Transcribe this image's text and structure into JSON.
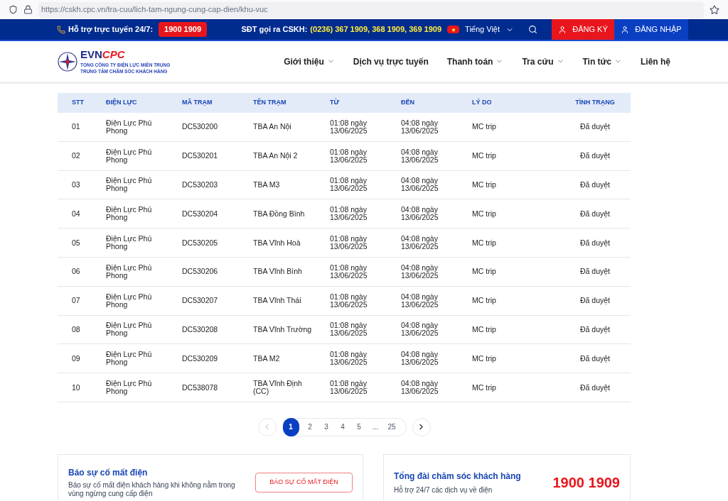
{
  "browser": {
    "url": "https://cskh.cpc.vn/tra-cuu/lich-tam-ngung-cung-cap-dien/khu-vuc"
  },
  "topbar": {
    "support_label": "Hỗ trợ trực tuyến 24/7:",
    "support_phone": "1900 1909",
    "cskh_label": "SĐT gọi ra CSKH:",
    "cskh_phones": "(0236) 367 1909, 368 1909, 369 1909",
    "language": "Tiếng Việt",
    "register": "ĐĂNG KÝ",
    "login": "ĐĂNG NHẬP"
  },
  "logo": {
    "brand_main": "EVN",
    "brand_accent": "CPC",
    "line_1": "TỔNG CÔNG TY ĐIỆN LỰC MIỀN TRUNG",
    "line_2": "TRUNG TÂM CHĂM SÓC KHÁCH HÀNG"
  },
  "nav": [
    {
      "label": "Giới thiệu",
      "dropdown": true
    },
    {
      "label": "Dịch vụ trực tuyến",
      "dropdown": false
    },
    {
      "label": "Thanh toán",
      "dropdown": true
    },
    {
      "label": "Tra cứu",
      "dropdown": true
    },
    {
      "label": "Tin tức",
      "dropdown": true
    },
    {
      "label": "Liên hệ",
      "dropdown": false
    }
  ],
  "table": {
    "columns": [
      "STT",
      "ĐIỆN LỰC",
      "MÃ TRẠM",
      "TÊN TRẠM",
      "TỪ",
      "ĐẾN",
      "LÝ DO",
      "TÌNH TRẠNG"
    ],
    "rows": [
      [
        "01",
        "Điện Lực Phú Phong",
        "DC530200",
        "TBA An Nội",
        "01:08 ngày 13/06/2025",
        "04:08 ngày 13/06/2025",
        "MC trip",
        "Đã duyệt"
      ],
      [
        "02",
        "Điện Lực Phú Phong",
        "DC530201",
        "TBA An Nội 2",
        "01:08 ngày 13/06/2025",
        "04:08 ngày 13/06/2025",
        "MC trip",
        "Đã duyệt"
      ],
      [
        "03",
        "Điện Lực Phú Phong",
        "DC530203",
        "TBA M3",
        "01:08 ngày 13/06/2025",
        "04:08 ngày 13/06/2025",
        "MC trip",
        "Đã duyệt"
      ],
      [
        "04",
        "Điện Lực Phú Phong",
        "DC530204",
        "TBA Đồng Bình",
        "01:08 ngày 13/06/2025",
        "04:08 ngày 13/06/2025",
        "MC trip",
        "Đã duyệt"
      ],
      [
        "05",
        "Điện Lực Phú Phong",
        "DC530205",
        "TBA Vĩnh Hoà",
        "01:08 ngày 13/06/2025",
        "04:08 ngày 13/06/2025",
        "MC trip",
        "Đã duyệt"
      ],
      [
        "06",
        "Điện Lực Phú Phong",
        "DC530206",
        "TBA Vĩnh Bình",
        "01:08 ngày 13/06/2025",
        "04:08 ngày 13/06/2025",
        "MC trip",
        "Đã duyệt"
      ],
      [
        "07",
        "Điện Lực Phú Phong",
        "DC530207",
        "TBA Vĩnh Thái",
        "01:08 ngày 13/06/2025",
        "04:08 ngày 13/06/2025",
        "MC trip",
        "Đã duyệt"
      ],
      [
        "08",
        "Điện Lực Phú Phong",
        "DC530208",
        "TBA Vĩnh Trường",
        "01:08 ngày 13/06/2025",
        "04:08 ngày 13/06/2025",
        "MC trip",
        "Đã duyệt"
      ],
      [
        "09",
        "Điện Lực Phú Phong",
        "DC530209",
        "TBA M2",
        "01:08 ngày 13/06/2025",
        "04:08 ngày 13/06/2025",
        "MC trip",
        "Đã duyệt"
      ],
      [
        "10",
        "Điện Lực Phú Phong",
        "DC538078",
        "TBA Vĩnh Định (CC)",
        "01:08 ngày 13/06/2025",
        "04:08 ngày 13/06/2025",
        "MC trip",
        "Đã duyệt"
      ]
    ]
  },
  "pagination": {
    "prev_disabled": true,
    "next_disabled": false,
    "pages": [
      {
        "label": "1",
        "selected": true
      },
      {
        "label": "2",
        "selected": false
      },
      {
        "label": "3",
        "selected": false
      },
      {
        "label": "4",
        "selected": false
      },
      {
        "label": "5",
        "selected": false
      },
      {
        "label": "...",
        "selected": false
      },
      {
        "label": "25",
        "selected": false
      }
    ]
  },
  "report_card": {
    "title": "Báo sự cố mất điện",
    "text": "Báo sự cố mất điện khách hàng khi không nằm trong vùng ngừng cung cấp điện",
    "button": "BÁO SỰ CỐ MẤT ĐIỆN"
  },
  "hotline_card": {
    "title": "Tổng đài chăm sóc khách hàng",
    "text": "Hỗ trợ 24/7 các dịch vụ về điện",
    "phone": "1900 1909"
  }
}
